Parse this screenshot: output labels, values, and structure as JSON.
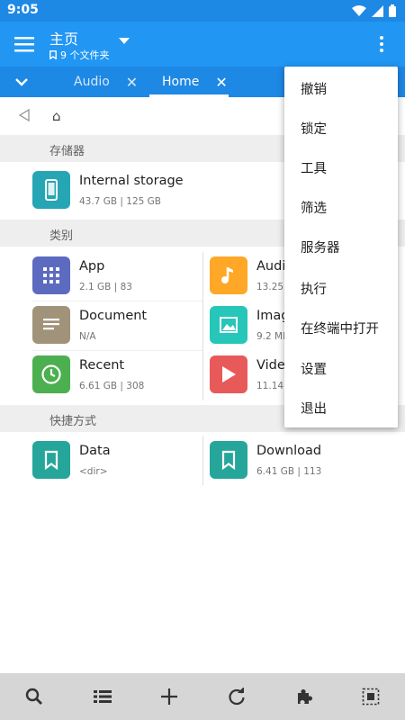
{
  "statusbar": {
    "time": "9:05"
  },
  "appbar": {
    "title": "主页",
    "subtitle": "9 个文件夹"
  },
  "tabs": [
    {
      "label": "Audio",
      "active": false
    },
    {
      "label": "Home",
      "active": true
    }
  ],
  "breadcrumb": {
    "home": "⌂"
  },
  "sections": {
    "storage": "存储器",
    "categories": "类别",
    "shortcuts": "快捷方式"
  },
  "storage": {
    "name": "Internal storage",
    "meta": "43.7 GB | 125 GB",
    "icon": "phone-icon",
    "color": "#26a6b5"
  },
  "categories": [
    {
      "name": "App",
      "meta": "2.1 GB | 83",
      "icon": "apps-grid-icon",
      "color": "#5c6bc0"
    },
    {
      "name": "Audi",
      "meta": "13.25",
      "icon": "music-note-icon",
      "color": "#ffa726"
    },
    {
      "name": "Document",
      "meta": "N/A",
      "icon": "document-icon",
      "color": "#a1937a"
    },
    {
      "name": "Imag",
      "meta": "9.2 MI",
      "icon": "image-icon",
      "color": "#26c6b9"
    },
    {
      "name": "Recent",
      "meta": "6.61 GB | 308",
      "icon": "clock-icon",
      "color": "#4caf50"
    },
    {
      "name": "Vide",
      "meta": "11.14",
      "icon": "play-icon",
      "color": "#e85a5a"
    }
  ],
  "shortcuts": [
    {
      "name": "Data",
      "meta": "<dir>",
      "icon": "bookmark-icon",
      "color": "#26a69a"
    },
    {
      "name": "Download",
      "meta": "6.41 GB | 113",
      "icon": "bookmark-icon",
      "color": "#26a69a"
    }
  ],
  "menu": [
    "撤销",
    "锁定",
    "工具",
    "筛选",
    "服务器",
    "执行",
    "在终端中打开",
    "设置",
    "退出"
  ],
  "bottom_icons": [
    "search-icon",
    "list-view-icon",
    "add-icon",
    "refresh-icon",
    "plugin-icon",
    "select-all-icon"
  ],
  "colors": {
    "primary": "#2196f3",
    "primary_dark": "#1e88e5",
    "section_bg": "#eeeeee",
    "bottombar_bg": "#d6d6d6"
  }
}
